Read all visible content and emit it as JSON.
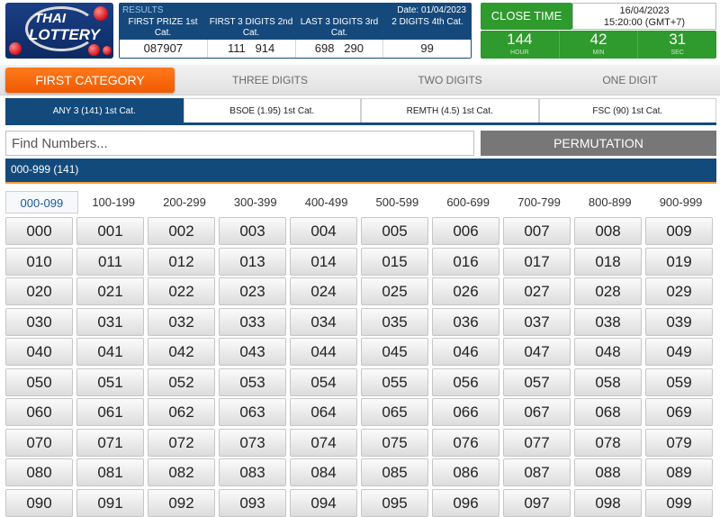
{
  "logo": {
    "line1": "THAI",
    "line2": "LOTTERY"
  },
  "results": {
    "heading": "RESULTS",
    "date": "Date: 01/04/2023",
    "columns": [
      "FIRST PRIZE 1st Cat.",
      "FIRST 3 DIGITS 2nd Cat.",
      "LAST 3 DIGITS 3rd Cat.",
      "2 DIGITS 4th Cat."
    ],
    "values": [
      "087907",
      "111   914",
      "698   290",
      "99"
    ]
  },
  "close": {
    "label": "CLOSE TIME",
    "date": "16/04/2023",
    "time": "15:20:00 (GMT+7)"
  },
  "countdown": [
    {
      "value": "144",
      "unit": "HOUR"
    },
    {
      "value": "42",
      "unit": "MIN"
    },
    {
      "value": "31",
      "unit": "SEC"
    }
  ],
  "categories": [
    "FIRST CATEGORY",
    "THREE DIGITS",
    "TWO DIGITS",
    "ONE DIGIT"
  ],
  "subtabs": [
    "ANY 3 (141) 1st Cat.",
    "BSOE (1.95) 1st Cat.",
    "REMTH (4.5) 1st Cat.",
    "FSC (90) 1st Cat."
  ],
  "search": {
    "placeholder": "Find Numbers..."
  },
  "permutation_label": "PERMUTATION",
  "range_title": "000-999 (141)",
  "ranges": [
    "000-099",
    "100-199",
    "200-299",
    "300-399",
    "400-499",
    "500-599",
    "600-699",
    "700-799",
    "800-899",
    "900-999"
  ],
  "numbers": [
    "000",
    "001",
    "002",
    "003",
    "004",
    "005",
    "006",
    "007",
    "008",
    "009",
    "010",
    "011",
    "012",
    "013",
    "014",
    "015",
    "016",
    "017",
    "018",
    "019",
    "020",
    "021",
    "022",
    "023",
    "024",
    "025",
    "026",
    "027",
    "028",
    "029",
    "030",
    "031",
    "032",
    "033",
    "034",
    "035",
    "036",
    "037",
    "038",
    "039",
    "040",
    "041",
    "042",
    "043",
    "044",
    "045",
    "046",
    "047",
    "048",
    "049",
    "050",
    "051",
    "052",
    "053",
    "054",
    "055",
    "056",
    "057",
    "058",
    "059",
    "060",
    "061",
    "062",
    "063",
    "064",
    "065",
    "066",
    "067",
    "068",
    "069",
    "070",
    "071",
    "072",
    "073",
    "074",
    "075",
    "076",
    "077",
    "078",
    "079",
    "080",
    "081",
    "082",
    "083",
    "084",
    "085",
    "086",
    "087",
    "088",
    "089",
    "090",
    "091",
    "092",
    "093",
    "094",
    "095",
    "096",
    "097",
    "098",
    "099"
  ]
}
